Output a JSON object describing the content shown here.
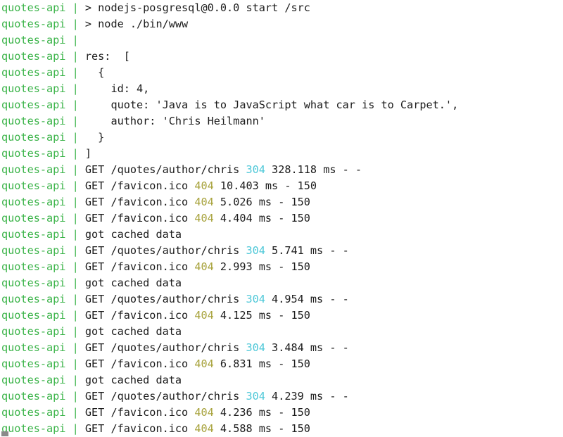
{
  "terminal": {
    "service_prefix": "quotes-api",
    "separator": "|",
    "background_color": "#ffffff",
    "prefix_color": "#3cb44a",
    "text_color": "#1c1c1c",
    "status_304_color": "#4ec8d8",
    "status_404_color": "#a7a23b",
    "cursor_color": "#8a8a8a",
    "lines": [
      {
        "segments": [
          {
            "text": "> nodejs-posgresql@0.0.0 start /src"
          }
        ]
      },
      {
        "segments": [
          {
            "text": "> node ./bin/www"
          }
        ]
      },
      {
        "segments": [
          {
            "text": ""
          }
        ]
      },
      {
        "segments": [
          {
            "text": "res:  ["
          }
        ]
      },
      {
        "segments": [
          {
            "text": "  {"
          }
        ]
      },
      {
        "segments": [
          {
            "text": "    id: 4,"
          }
        ]
      },
      {
        "segments": [
          {
            "text": "    quote: 'Java is to JavaScript what car is to Carpet.',"
          }
        ]
      },
      {
        "segments": [
          {
            "text": "    author: 'Chris Heilmann'"
          }
        ]
      },
      {
        "segments": [
          {
            "text": "  }"
          }
        ]
      },
      {
        "segments": [
          {
            "text": "]"
          }
        ]
      },
      {
        "segments": [
          {
            "text": "GET /quotes/author/chris "
          },
          {
            "text": "304",
            "style": "sc-304"
          },
          {
            "text": " 328.118 ms - -"
          }
        ]
      },
      {
        "segments": [
          {
            "text": "GET /favicon.ico "
          },
          {
            "text": "404",
            "style": "sc-404"
          },
          {
            "text": " 10.403 ms - 150"
          }
        ]
      },
      {
        "segments": [
          {
            "text": "GET /favicon.ico "
          },
          {
            "text": "404",
            "style": "sc-404"
          },
          {
            "text": " 5.026 ms - 150"
          }
        ]
      },
      {
        "segments": [
          {
            "text": "GET /favicon.ico "
          },
          {
            "text": "404",
            "style": "sc-404"
          },
          {
            "text": " 4.404 ms - 150"
          }
        ]
      },
      {
        "segments": [
          {
            "text": "got cached data"
          }
        ]
      },
      {
        "segments": [
          {
            "text": "GET /quotes/author/chris "
          },
          {
            "text": "304",
            "style": "sc-304"
          },
          {
            "text": " 5.741 ms - -"
          }
        ]
      },
      {
        "segments": [
          {
            "text": "GET /favicon.ico "
          },
          {
            "text": "404",
            "style": "sc-404"
          },
          {
            "text": " 2.993 ms - 150"
          }
        ]
      },
      {
        "segments": [
          {
            "text": "got cached data"
          }
        ]
      },
      {
        "segments": [
          {
            "text": "GET /quotes/author/chris "
          },
          {
            "text": "304",
            "style": "sc-304"
          },
          {
            "text": " 4.954 ms - -"
          }
        ]
      },
      {
        "segments": [
          {
            "text": "GET /favicon.ico "
          },
          {
            "text": "404",
            "style": "sc-404"
          },
          {
            "text": " 4.125 ms - 150"
          }
        ]
      },
      {
        "segments": [
          {
            "text": "got cached data"
          }
        ]
      },
      {
        "segments": [
          {
            "text": "GET /quotes/author/chris "
          },
          {
            "text": "304",
            "style": "sc-304"
          },
          {
            "text": " 3.484 ms - -"
          }
        ]
      },
      {
        "segments": [
          {
            "text": "GET /favicon.ico "
          },
          {
            "text": "404",
            "style": "sc-404"
          },
          {
            "text": " 6.831 ms - 150"
          }
        ]
      },
      {
        "segments": [
          {
            "text": "got cached data"
          }
        ]
      },
      {
        "segments": [
          {
            "text": "GET /quotes/author/chris "
          },
          {
            "text": "304",
            "style": "sc-304"
          },
          {
            "text": " 4.239 ms - -"
          }
        ]
      },
      {
        "segments": [
          {
            "text": "GET /favicon.ico "
          },
          {
            "text": "404",
            "style": "sc-404"
          },
          {
            "text": " 4.236 ms - 150"
          }
        ]
      },
      {
        "segments": [
          {
            "text": "GET /favicon.ico "
          },
          {
            "text": "404",
            "style": "sc-404"
          },
          {
            "text": " 4.588 ms - 150"
          }
        ]
      }
    ]
  }
}
